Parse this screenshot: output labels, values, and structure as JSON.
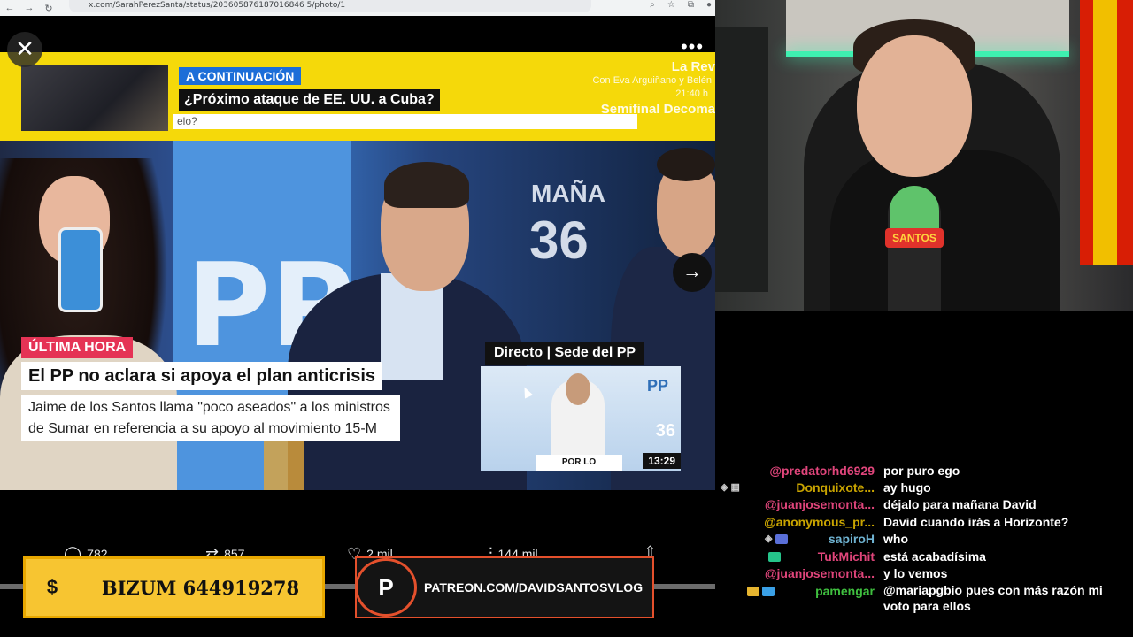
{
  "browser": {
    "url": "x.com/SarahPerezSanta/status/203605876187016846 5/photo/1"
  },
  "viewer": {
    "close_symbol": "✕",
    "more_symbol": "•••",
    "next_symbol": "→"
  },
  "tv": {
    "a_continuacion": "A CONTINUACIÓN",
    "proximo": "¿Próximo ataque de EE. UU. a Cuba?",
    "ticker": "elo?",
    "la_rev": "La Rev",
    "la_rev_sub": "Con Eva Arguiñano y Belén",
    "la_rev_time": "21:40 h",
    "semifinal": "Semifinal Decoma",
    "pp_text": "PP",
    "manana": "MAÑA",
    "bg_36": "36",
    "ultima_hora": "ÚLTIMA HORA",
    "headline": "El PP no aclara si apoya el plan anticrisis",
    "subtext": "Jaime de los Santos llama \"poco aseados\" a los ministros de Sumar en referencia a su apoyo al movimiento 15-M",
    "directo": "Directo | Sede del PP",
    "inset_pp": "PP",
    "inset_36": "36",
    "por_lo_importante": "POR LO IMPORTANTE",
    "inset_time": "13:29"
  },
  "tweet_actions": {
    "replies": "782",
    "reposts": "857",
    "likes": "2 mil",
    "views": "144 mil"
  },
  "banners": {
    "bizum_symbol": "$",
    "bizum": "BIZUM 644919278",
    "patreon_symbol": "P",
    "patreon": "PATREON.COM/DAVIDSANTOSVLOG"
  },
  "webcam": {
    "mic_label": "SANTOS"
  },
  "chat": [
    {
      "user": "@predatorhd6929",
      "color": "#e0457b",
      "text": "por puro ego"
    },
    {
      "user": "Donquixote...",
      "color": "#c9a400",
      "text": "ay hugo"
    },
    {
      "user": "@juanjosemonta...",
      "color": "#e0457b",
      "text": "déjalo para mañana David"
    },
    {
      "user": "@anonymous_pr...",
      "color": "#c9a400",
      "text": "David cuando irás a Horizonte?"
    },
    {
      "user": "sapiroH",
      "color": "#6fb3d2",
      "text": "who"
    },
    {
      "user": "TukMichit",
      "color": "#e0457b",
      "text": "está acabadísima"
    },
    {
      "user": "@juanjosemonta...",
      "color": "#e0457b",
      "text": "y lo vemos"
    },
    {
      "user": "pamengar",
      "color": "#3fbf3f",
      "text": "@mariapgbio pues con más razón mi voto para ellos"
    }
  ],
  "colors": {
    "accent_yellow": "#f5d90a",
    "ultima_red": "#e53355",
    "continuacion_blue": "#1c6ed8",
    "patreon_orange": "#e4502c",
    "bizum_yellow": "#f7c531"
  }
}
